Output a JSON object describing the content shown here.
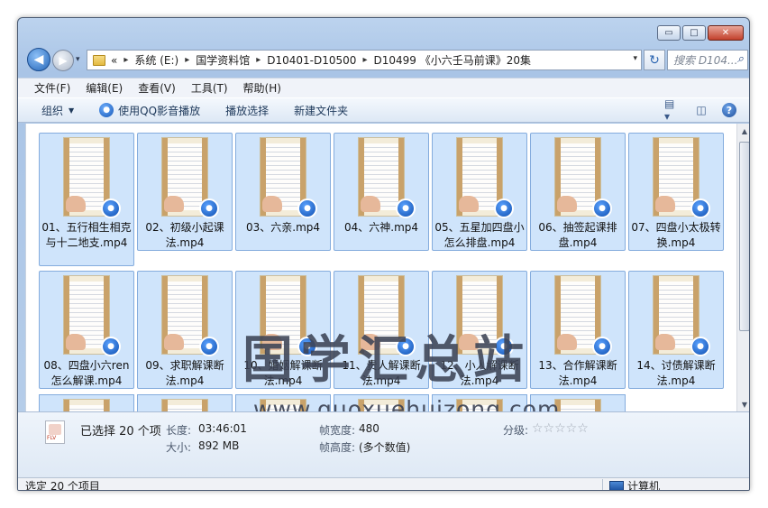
{
  "window": {
    "minimize": "▭",
    "maximize": "□",
    "close": "✕"
  },
  "nav": {
    "back": "◀",
    "forward": "▶",
    "history": "▾",
    "breadcrumbs": [
      "«",
      "系统 (E:)",
      "国学资料馆",
      "D10401-D10500",
      "D10499 《小六壬马前课》20集"
    ],
    "refresh": "↻",
    "search_placeholder": "搜索 D104...",
    "search_icon": "⌕"
  },
  "menu": [
    "文件(F)",
    "编辑(E)",
    "查看(V)",
    "工具(T)",
    "帮助(H)"
  ],
  "toolbar": {
    "organize": "组织",
    "play_qq": "使用QQ影音播放",
    "play_selected": "播放选择",
    "new_folder": "新建文件夹",
    "help": "?"
  },
  "files": [
    "01、五行相生相克与十二地支.mp4",
    "02、初级小起课法.mp4",
    "03、六亲.mp4",
    "04、六神.mp4",
    "05、五星加四盘小怎么排盘.mp4",
    "06、抽签起课排盘.mp4",
    "07、四盘小太极转换.mp4",
    "08、四盘小六ren怎么解课.mp4",
    "09、求职解课断法.mp4",
    "10、婚姻解课断法.mp4",
    "11、贵人解课断法.mp4",
    "12、小人解课断法.mp4",
    "13、合作解课断法.mp4",
    "14、讨债解课断法.mp4"
  ],
  "watermark": {
    "cn": "国学汇总站",
    "url": "www.guoxuehuizong.com"
  },
  "details": {
    "selected": "已选择 20 个项",
    "length_label": "长度:",
    "length_value": "03:46:01",
    "size_label": "大小:",
    "size_value": "892 MB",
    "frame_width_label": "帧宽度:",
    "frame_width_value": "480",
    "frame_height_label": "帧高度:",
    "frame_height_value": "(多个数值)",
    "rating_label": "分级:",
    "rating_stars": "☆☆☆☆☆",
    "icon_tag": "FLV"
  },
  "status": {
    "left": "选定 20 个项目",
    "right": "计算机"
  }
}
